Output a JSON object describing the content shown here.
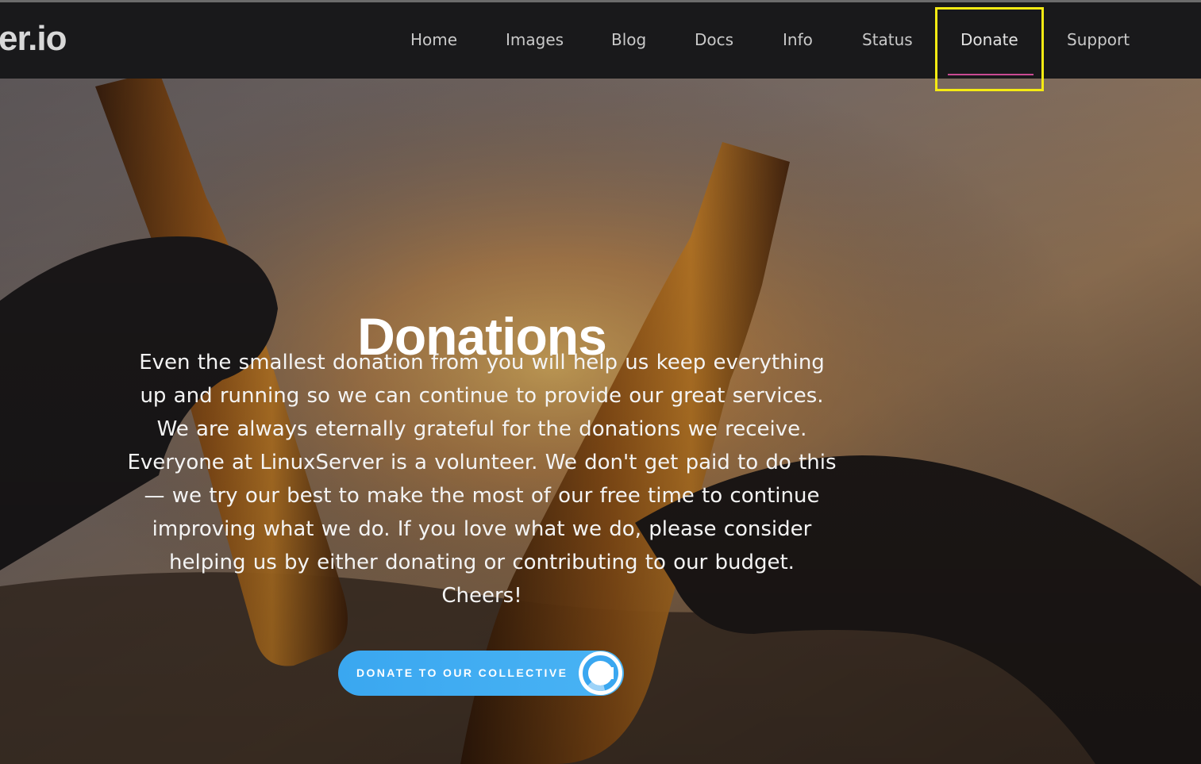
{
  "brand": {
    "logo_text": "er.io"
  },
  "nav": {
    "items": [
      {
        "label": "Home"
      },
      {
        "label": "Images"
      },
      {
        "label": "Blog"
      },
      {
        "label": "Docs"
      },
      {
        "label": "Info"
      },
      {
        "label": "Status"
      },
      {
        "label": "Donate",
        "active": true
      },
      {
        "label": "Support"
      }
    ]
  },
  "hero": {
    "title": "Donations",
    "body": "Even the smallest donation from you will help us keep everything up and running so we can continue to provide our great services. We are always eternally grateful for the donations we receive. Everyone at LinuxServer is a volunteer. We don't get paid to do this — we try our best to make the most of our free time to continue improving what we do. If you love what we do, please consider helping us by either donating or contributing to our budget. Cheers!",
    "button_label": "DONATE TO OUR COLLECTIVE",
    "button_icon": "opencollective-icon"
  },
  "colors": {
    "navbar_bg": "#19191b",
    "active_underline": "#c94a93",
    "highlight": "#f5ea13",
    "button": "#3aa7f0"
  }
}
